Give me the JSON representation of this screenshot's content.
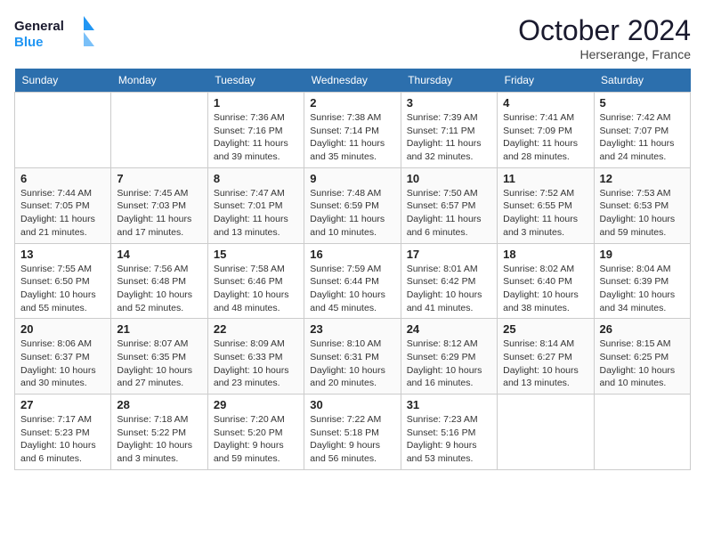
{
  "header": {
    "logo_line1": "General",
    "logo_line2": "Blue",
    "month": "October 2024",
    "location": "Herserange, France"
  },
  "days_of_week": [
    "Sunday",
    "Monday",
    "Tuesday",
    "Wednesday",
    "Thursday",
    "Friday",
    "Saturday"
  ],
  "weeks": [
    [
      {
        "day": "",
        "info": ""
      },
      {
        "day": "",
        "info": ""
      },
      {
        "day": "1",
        "info": "Sunrise: 7:36 AM\nSunset: 7:16 PM\nDaylight: 11 hours and 39 minutes."
      },
      {
        "day": "2",
        "info": "Sunrise: 7:38 AM\nSunset: 7:14 PM\nDaylight: 11 hours and 35 minutes."
      },
      {
        "day": "3",
        "info": "Sunrise: 7:39 AM\nSunset: 7:11 PM\nDaylight: 11 hours and 32 minutes."
      },
      {
        "day": "4",
        "info": "Sunrise: 7:41 AM\nSunset: 7:09 PM\nDaylight: 11 hours and 28 minutes."
      },
      {
        "day": "5",
        "info": "Sunrise: 7:42 AM\nSunset: 7:07 PM\nDaylight: 11 hours and 24 minutes."
      }
    ],
    [
      {
        "day": "6",
        "info": "Sunrise: 7:44 AM\nSunset: 7:05 PM\nDaylight: 11 hours and 21 minutes."
      },
      {
        "day": "7",
        "info": "Sunrise: 7:45 AM\nSunset: 7:03 PM\nDaylight: 11 hours and 17 minutes."
      },
      {
        "day": "8",
        "info": "Sunrise: 7:47 AM\nSunset: 7:01 PM\nDaylight: 11 hours and 13 minutes."
      },
      {
        "day": "9",
        "info": "Sunrise: 7:48 AM\nSunset: 6:59 PM\nDaylight: 11 hours and 10 minutes."
      },
      {
        "day": "10",
        "info": "Sunrise: 7:50 AM\nSunset: 6:57 PM\nDaylight: 11 hours and 6 minutes."
      },
      {
        "day": "11",
        "info": "Sunrise: 7:52 AM\nSunset: 6:55 PM\nDaylight: 11 hours and 3 minutes."
      },
      {
        "day": "12",
        "info": "Sunrise: 7:53 AM\nSunset: 6:53 PM\nDaylight: 10 hours and 59 minutes."
      }
    ],
    [
      {
        "day": "13",
        "info": "Sunrise: 7:55 AM\nSunset: 6:50 PM\nDaylight: 10 hours and 55 minutes."
      },
      {
        "day": "14",
        "info": "Sunrise: 7:56 AM\nSunset: 6:48 PM\nDaylight: 10 hours and 52 minutes."
      },
      {
        "day": "15",
        "info": "Sunrise: 7:58 AM\nSunset: 6:46 PM\nDaylight: 10 hours and 48 minutes."
      },
      {
        "day": "16",
        "info": "Sunrise: 7:59 AM\nSunset: 6:44 PM\nDaylight: 10 hours and 45 minutes."
      },
      {
        "day": "17",
        "info": "Sunrise: 8:01 AM\nSunset: 6:42 PM\nDaylight: 10 hours and 41 minutes."
      },
      {
        "day": "18",
        "info": "Sunrise: 8:02 AM\nSunset: 6:40 PM\nDaylight: 10 hours and 38 minutes."
      },
      {
        "day": "19",
        "info": "Sunrise: 8:04 AM\nSunset: 6:39 PM\nDaylight: 10 hours and 34 minutes."
      }
    ],
    [
      {
        "day": "20",
        "info": "Sunrise: 8:06 AM\nSunset: 6:37 PM\nDaylight: 10 hours and 30 minutes."
      },
      {
        "day": "21",
        "info": "Sunrise: 8:07 AM\nSunset: 6:35 PM\nDaylight: 10 hours and 27 minutes."
      },
      {
        "day": "22",
        "info": "Sunrise: 8:09 AM\nSunset: 6:33 PM\nDaylight: 10 hours and 23 minutes."
      },
      {
        "day": "23",
        "info": "Sunrise: 8:10 AM\nSunset: 6:31 PM\nDaylight: 10 hours and 20 minutes."
      },
      {
        "day": "24",
        "info": "Sunrise: 8:12 AM\nSunset: 6:29 PM\nDaylight: 10 hours and 16 minutes."
      },
      {
        "day": "25",
        "info": "Sunrise: 8:14 AM\nSunset: 6:27 PM\nDaylight: 10 hours and 13 minutes."
      },
      {
        "day": "26",
        "info": "Sunrise: 8:15 AM\nSunset: 6:25 PM\nDaylight: 10 hours and 10 minutes."
      }
    ],
    [
      {
        "day": "27",
        "info": "Sunrise: 7:17 AM\nSunset: 5:23 PM\nDaylight: 10 hours and 6 minutes."
      },
      {
        "day": "28",
        "info": "Sunrise: 7:18 AM\nSunset: 5:22 PM\nDaylight: 10 hours and 3 minutes."
      },
      {
        "day": "29",
        "info": "Sunrise: 7:20 AM\nSunset: 5:20 PM\nDaylight: 9 hours and 59 minutes."
      },
      {
        "day": "30",
        "info": "Sunrise: 7:22 AM\nSunset: 5:18 PM\nDaylight: 9 hours and 56 minutes."
      },
      {
        "day": "31",
        "info": "Sunrise: 7:23 AM\nSunset: 5:16 PM\nDaylight: 9 hours and 53 minutes."
      },
      {
        "day": "",
        "info": ""
      },
      {
        "day": "",
        "info": ""
      }
    ]
  ]
}
